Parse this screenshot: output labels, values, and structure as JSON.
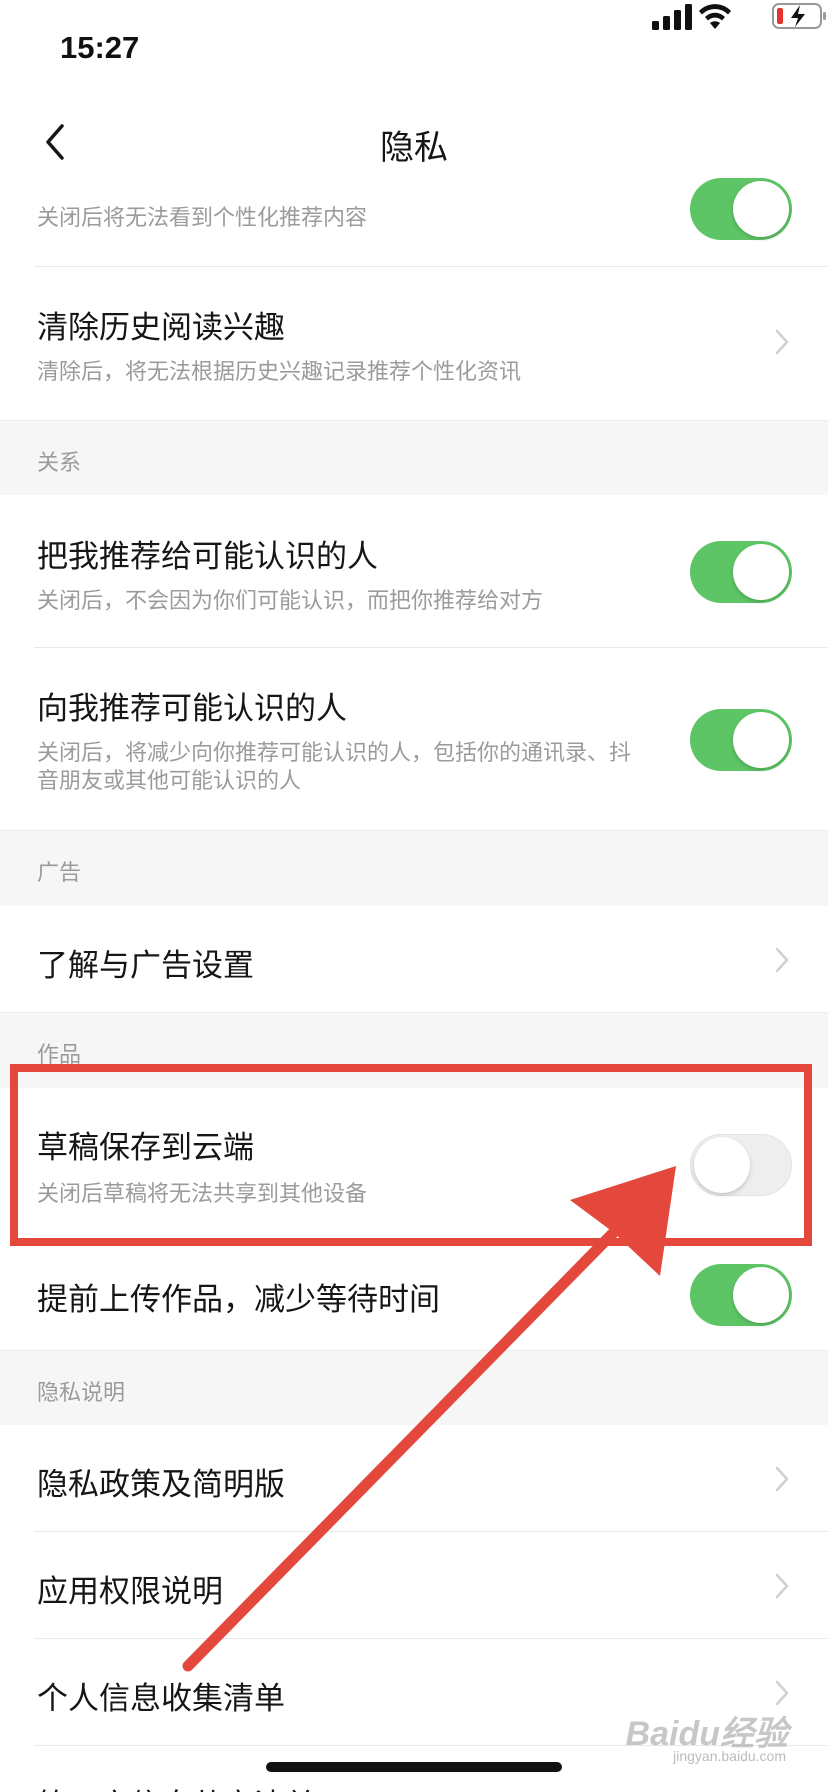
{
  "status_bar": {
    "time": "15:27"
  },
  "nav": {
    "title": "隐私"
  },
  "rows": {
    "personalized": {
      "desc": "关闭后将无法看到个性化推荐内容",
      "toggle_on": true
    },
    "clear_history": {
      "title": "清除历史阅读兴趣",
      "desc": "清除后，将无法根据历史兴趣记录推荐个性化资讯"
    },
    "recommend_me": {
      "title": "把我推荐给可能认识的人",
      "desc": "关闭后，不会因为你们可能认识，而把你推荐给对方",
      "toggle_on": true
    },
    "recommend_to_me": {
      "title": "向我推荐可能认识的人",
      "desc": "关闭后，将减少向你推荐可能认识的人，包括你的通讯录、抖音朋友或其他可能认识的人",
      "toggle_on": true
    },
    "ad_settings": {
      "title": "了解与广告设置"
    },
    "draft_cloud": {
      "title": "草稿保存到云端",
      "desc": "关闭后草稿将无法共享到其他设备",
      "toggle_on": false
    },
    "pre_upload": {
      "title": "提前上传作品，减少等待时间",
      "toggle_on": true
    },
    "privacy_policy": {
      "title": "隐私政策及简明版"
    },
    "app_permissions": {
      "title": "应用权限说明"
    },
    "info_collection": {
      "title": "个人信息收集清单"
    },
    "third_party": {
      "title": "第三方信息共享清单"
    }
  },
  "sections": {
    "relations": "关系",
    "ads": "广告",
    "works": "作品",
    "privacy_notes": "隐私说明"
  },
  "watermark": {
    "brand": "Baidu经验",
    "url": "jingyan.baidu.com"
  },
  "colors": {
    "toggle_on": "#5ec566",
    "highlight": "#e4483c"
  }
}
